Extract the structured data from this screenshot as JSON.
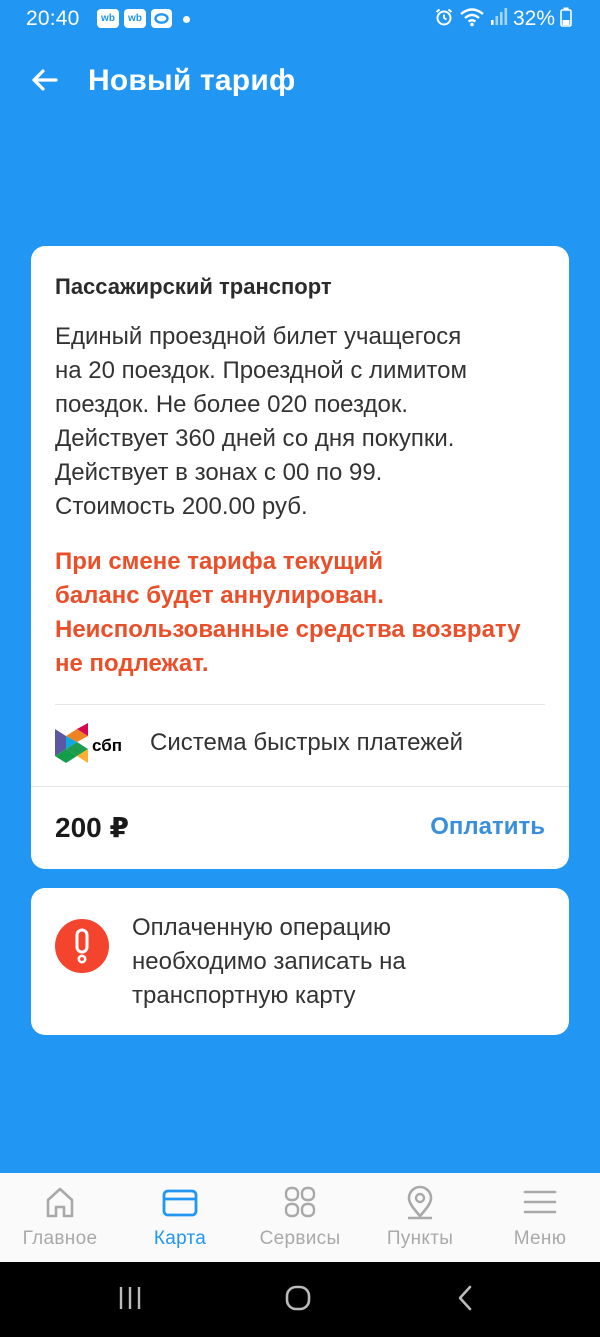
{
  "status_bar": {
    "time": "20:40",
    "notifications": [
      "wb",
      "wb"
    ],
    "battery": "32%"
  },
  "app_bar": {
    "title": "Новый тариф"
  },
  "tariff": {
    "title": "Пассажирский транспорт",
    "description_lines": [
      "Единый проездной билет учащегося",
      "на 20 поездок. Проездной с лимитом",
      "поездок. Не более 020 поездок.",
      "Действует 360 дней со дня покупки.",
      "Действует в зонах с 00 по 99.",
      "Стоимость 200.00 руб."
    ],
    "warning_lines": [
      "При смене тарифа текущий",
      "баланс будет аннулирован.",
      "Неиспользованные средства возврату",
      "не подлежат."
    ],
    "payment_method": {
      "logo_text": "сбп",
      "label": "Система быстрых платежей"
    },
    "price": "200 ₽",
    "pay_label": "Оплатить"
  },
  "info": {
    "lines": [
      "Оплаченную операцию",
      "необходимо записать на",
      "транспортную карту"
    ]
  },
  "bottom_nav": {
    "items": [
      {
        "label": "Главное",
        "icon": "home-icon",
        "active": false
      },
      {
        "label": "Карта",
        "icon": "card-icon",
        "active": true
      },
      {
        "label": "Сервисы",
        "icon": "services-grid-icon",
        "active": false
      },
      {
        "label": "Пункты",
        "icon": "location-pin-icon",
        "active": false
      },
      {
        "label": "Меню",
        "icon": "menu-icon",
        "active": false
      }
    ]
  },
  "colors": {
    "primary": "#2196f3",
    "warning": "#ea4f2a",
    "link": "#3a8fdc",
    "nav_inactive": "#a9a9a9"
  }
}
